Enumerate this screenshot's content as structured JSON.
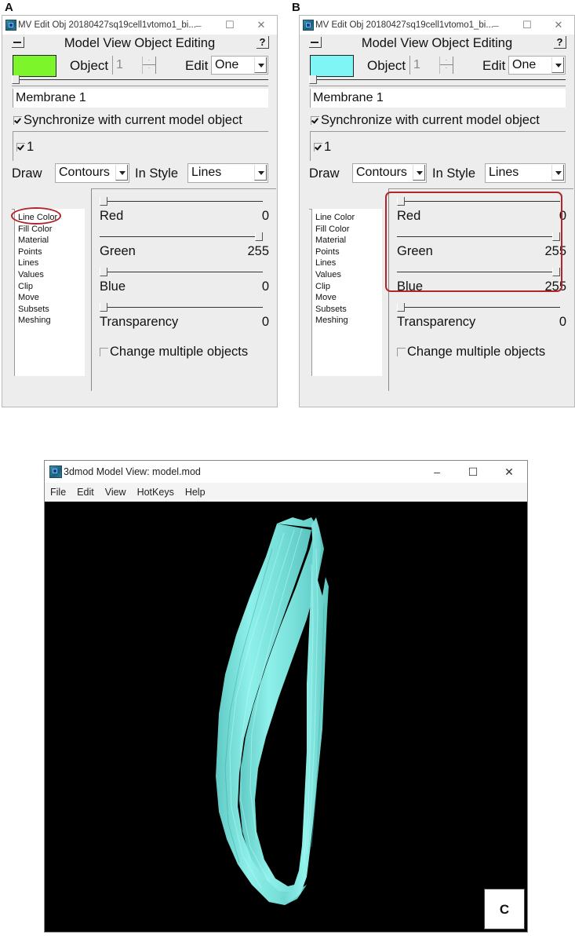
{
  "panels": {
    "a": {
      "label": "A",
      "window_title": "MV Edit Obj 20180427sq19cell1vtomo1_bi...",
      "controls": {
        "minimize": "–",
        "maximize": "☐",
        "close": "✕"
      },
      "heading": "Model View Object Editing",
      "help_label": "?",
      "swatch_color": "#7cf52a",
      "object_label": "Object",
      "object_value": "1",
      "edit_label": "Edit",
      "edit_value": "One",
      "object_slider_fraction": 0,
      "name_value": "Membrane 1",
      "sync_label": "Synchronize with current model object",
      "sync_checked": true,
      "object_check_label": "1",
      "object_checked": true,
      "draw_label": "Draw",
      "draw_value": "Contours",
      "style_label": "In Style",
      "style_value": "Lines",
      "list_items": [
        "Line Color",
        "Fill Color",
        "Material",
        "Points",
        "Lines",
        "Values",
        "Clip",
        "Move",
        "Subsets",
        "Meshing"
      ],
      "properties": [
        {
          "label": "Red",
          "value": "0",
          "fraction": 0
        },
        {
          "label": "Green",
          "value": "255",
          "fraction": 1
        },
        {
          "label": "Blue",
          "value": "0",
          "fraction": 0
        },
        {
          "label": "Transparency",
          "value": "0",
          "fraction": 0
        }
      ],
      "multi_label": "Change multiple objects",
      "multi_checked": false,
      "highlight": "Line Color"
    },
    "b": {
      "label": "B",
      "window_title": "MV Edit Obj 20180427sq19cell1vtomo1_bi...",
      "controls": {
        "minimize": "–",
        "maximize": "☐",
        "close": "✕"
      },
      "heading": "Model View Object Editing",
      "help_label": "?",
      "swatch_color": "#7ff5f5",
      "object_label": "Object",
      "object_value": "1",
      "edit_label": "Edit",
      "edit_value": "One",
      "object_slider_fraction": 0,
      "name_value": "Membrane 1",
      "sync_label": "Synchronize with current model object",
      "sync_checked": true,
      "object_check_label": "1",
      "object_checked": true,
      "draw_label": "Draw",
      "draw_value": "Contours",
      "style_label": "In Style",
      "style_value": "Lines",
      "list_items": [
        "Line Color",
        "Fill Color",
        "Material",
        "Points",
        "Lines",
        "Values",
        "Clip",
        "Move",
        "Subsets",
        "Meshing"
      ],
      "properties": [
        {
          "label": "Red",
          "value": "0",
          "fraction": 0
        },
        {
          "label": "Green",
          "value": "255",
          "fraction": 1
        },
        {
          "label": "Blue",
          "value": "255",
          "fraction": 1
        },
        {
          "label": "Transparency",
          "value": "0",
          "fraction": 0
        }
      ],
      "multi_label": "Change multiple objects",
      "multi_checked": false,
      "highlight": "Red/Green/Blue sliders"
    },
    "c": {
      "label": "C",
      "window_title": "3dmod Model View:  model.mod",
      "controls": {
        "minimize": "–",
        "maximize": "☐",
        "close": "✕"
      },
      "menu": [
        "File",
        "Edit",
        "View",
        "HotKeys",
        "Help"
      ],
      "model_color": "#7fe6e0",
      "background_color": "#000000"
    }
  },
  "annotation_color": "#b0262b"
}
